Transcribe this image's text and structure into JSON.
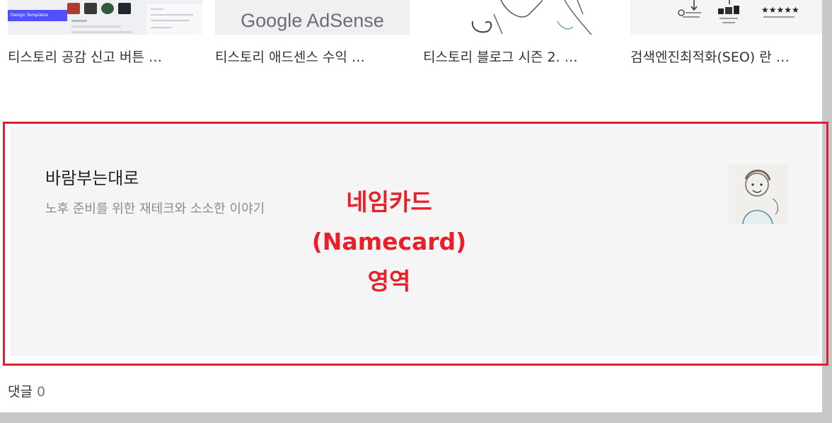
{
  "related_posts": [
    {
      "title": "티스토리 공감 신고 버튼 …",
      "thumb_caption": "Design Templates"
    },
    {
      "title": "티스토리 애드센스 수익 …",
      "thumb_text": "Google AdSense"
    },
    {
      "title": "티스토리 블로그 시즌 2. …"
    },
    {
      "title": "검색엔진최적화(SEO) 란 …"
    }
  ],
  "namecard": {
    "blog_name": "바람부는대로",
    "description": "노후 준비를 위한 재테크와 소소한 이야기",
    "annotation": [
      "네임카드",
      "(Namecard)",
      "영역"
    ],
    "annotation_color": "#e8202a",
    "frame_color": "#d9232e"
  },
  "comments": {
    "label": "댓글",
    "count": "0"
  }
}
